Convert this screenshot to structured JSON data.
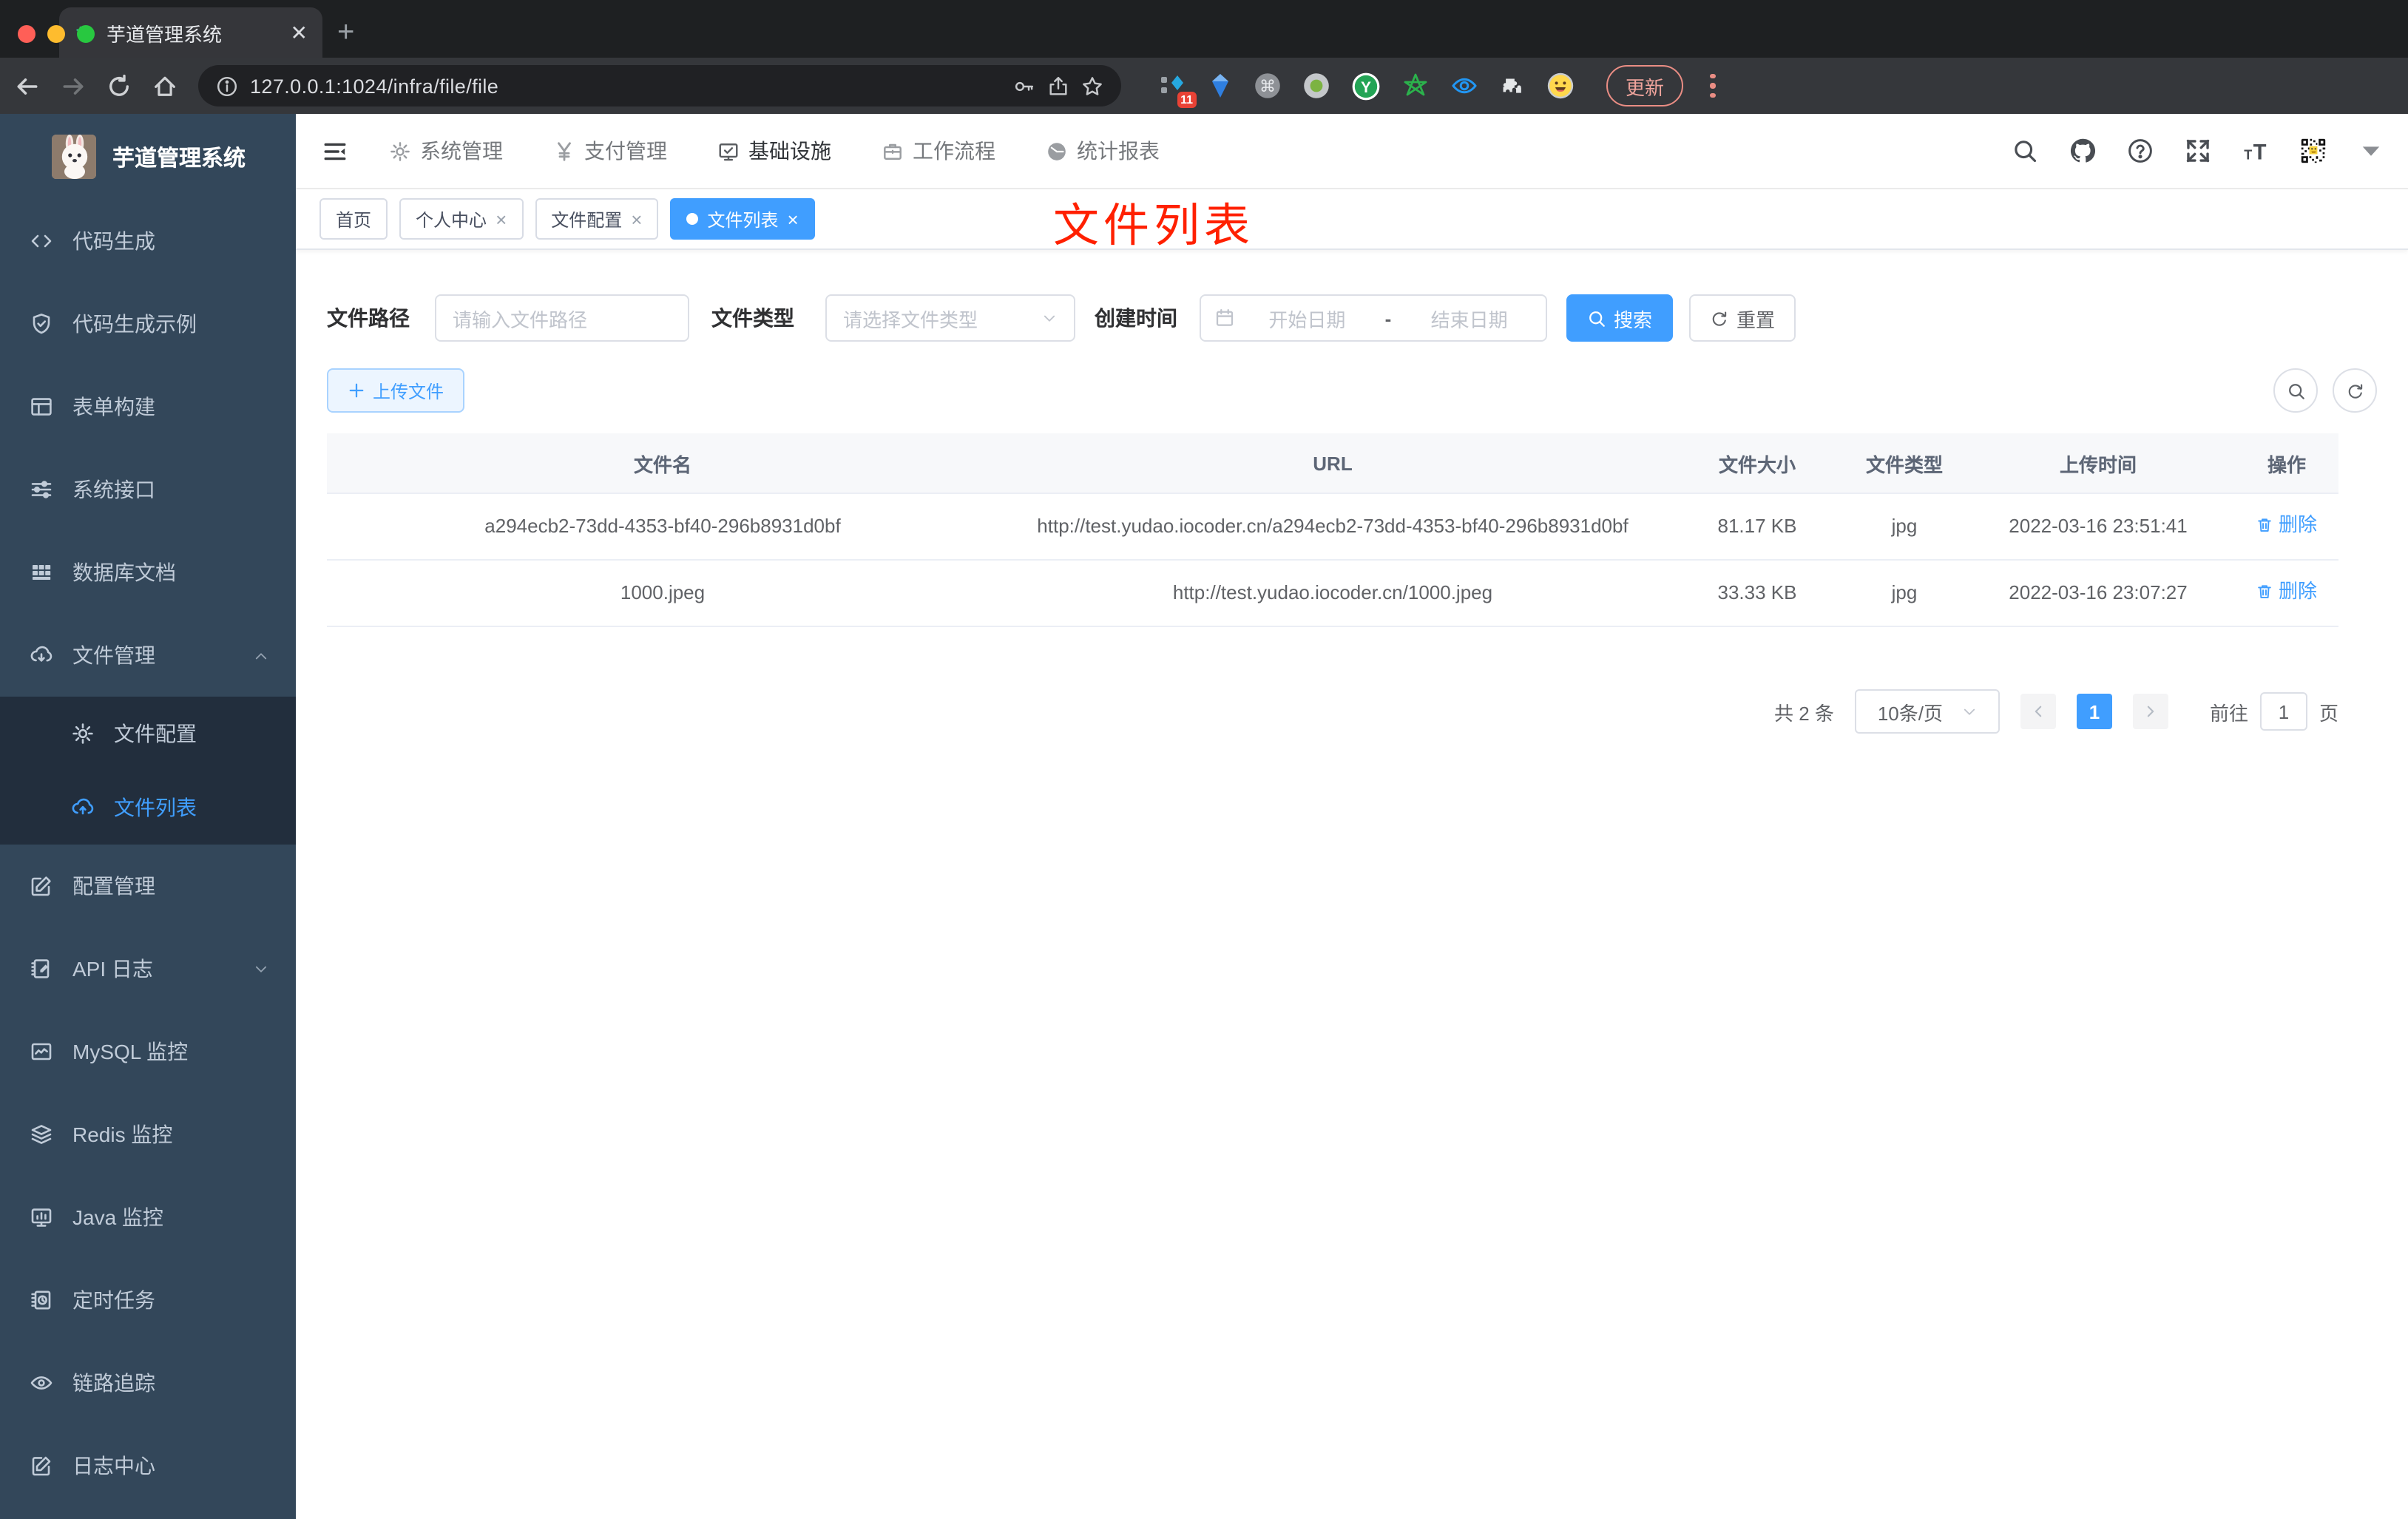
{
  "browser": {
    "tab_title": "芋道管理系统",
    "url": "127.0.0.1:1024/infra/file/file",
    "extension_badge": "11",
    "update_label": "更新"
  },
  "sidebar": {
    "title": "芋道管理系统",
    "items": [
      {
        "label": "代码生成",
        "icon": "code-icon"
      },
      {
        "label": "代码生成示例",
        "icon": "shield-check-icon"
      },
      {
        "label": "表单构建",
        "icon": "form-build-icon"
      },
      {
        "label": "系统接口",
        "icon": "sliders-icon"
      },
      {
        "label": "数据库文档",
        "icon": "table-grid-icon"
      },
      {
        "label": "文件管理",
        "icon": "cloud-download-icon",
        "expand": "up",
        "children": [
          {
            "label": "文件配置",
            "icon": "gear-icon"
          },
          {
            "label": "文件列表",
            "icon": "cloud-upload-icon",
            "active": true
          }
        ]
      },
      {
        "label": "配置管理",
        "icon": "edit-square-icon"
      },
      {
        "label": "API 日志",
        "icon": "notebook-edit-icon",
        "expand": "down"
      },
      {
        "label": "MySQL 监控",
        "icon": "chart-monitor-icon"
      },
      {
        "label": "Redis 监控",
        "icon": "layers-icon"
      },
      {
        "label": "Java 监控",
        "icon": "display-icon"
      },
      {
        "label": "定时任务",
        "icon": "timer-icon"
      },
      {
        "label": "链路追踪",
        "icon": "eye-icon"
      },
      {
        "label": "日志中心",
        "icon": "log-edit-icon"
      }
    ]
  },
  "header": {
    "nav": [
      {
        "label": "系统管理",
        "icon": "gear-icon"
      },
      {
        "label": "支付管理",
        "icon": "yen-icon"
      },
      {
        "label": "基础设施",
        "icon": "monitor-check-icon",
        "active": true
      },
      {
        "label": "工作流程",
        "icon": "briefcase-icon"
      },
      {
        "label": "统计报表",
        "icon": "dashboard-icon"
      }
    ]
  },
  "tabs": [
    {
      "label": "首页"
    },
    {
      "label": "个人中心",
      "closable": true
    },
    {
      "label": "文件配置",
      "closable": true
    },
    {
      "label": "文件列表",
      "closable": true,
      "active": true
    }
  ],
  "annotation": "文件列表",
  "filters": {
    "path_label": "文件路径",
    "path_placeholder": "请输入文件路径",
    "type_label": "文件类型",
    "type_placeholder": "请选择文件类型",
    "date_label": "创建时间",
    "date_start": "开始日期",
    "date_separator": "-",
    "date_end": "结束日期",
    "search_label": "搜索",
    "reset_label": "重置"
  },
  "toolbar": {
    "upload_label": "上传文件"
  },
  "table": {
    "headers": [
      "文件名",
      "URL",
      "文件大小",
      "文件类型",
      "上传时间",
      "操作"
    ],
    "rows": [
      {
        "name": "a294ecb2-73dd-4353-bf40-296b8931d0bf",
        "url": "http://test.yudao.iocoder.cn/a294ecb2-73dd-4353-bf40-296b8931d0bf",
        "size": "81.17 KB",
        "type": "jpg",
        "time": "2022-03-16 23:51:41",
        "action": "删除"
      },
      {
        "name": "1000.jpeg",
        "url": "http://test.yudao.iocoder.cn/1000.jpeg",
        "size": "33.33 KB",
        "type": "jpg",
        "time": "2022-03-16 23:07:27",
        "action": "删除"
      }
    ]
  },
  "pagination": {
    "total": "共 2 条",
    "page_size": "10条/页",
    "current": "1",
    "goto_label": "前往",
    "goto_value": "1",
    "page_label": "页"
  },
  "colors": {
    "accent": "#409eff",
    "annotation": "#ff2000",
    "sidebar_bg": "#33475a",
    "submenu_bg": "#222e3d"
  }
}
